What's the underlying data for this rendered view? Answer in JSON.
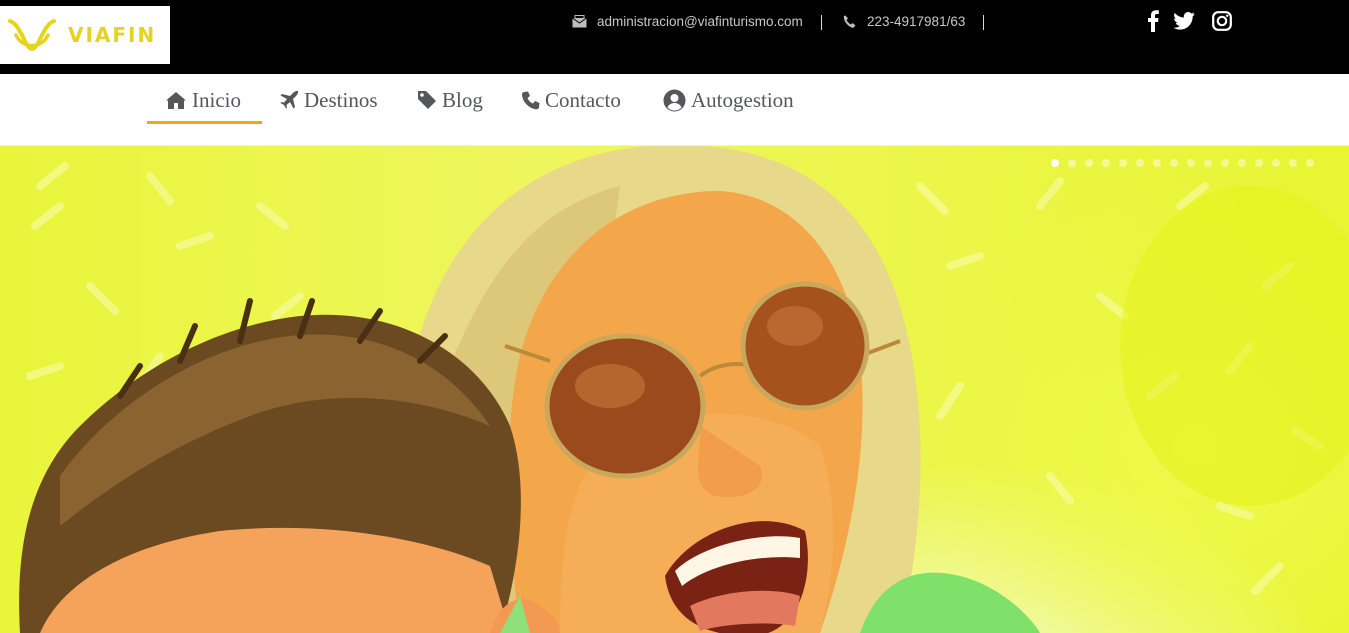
{
  "header": {
    "logo_text": "VIAFIN",
    "email": "administracion@viafinturismo.com",
    "phone": "223-4917981/63",
    "social": [
      {
        "icon": "facebook-icon"
      },
      {
        "icon": "twitter-icon"
      },
      {
        "icon": "instagram-icon"
      }
    ]
  },
  "nav": {
    "items": [
      {
        "label": "Inicio",
        "icon": "home-icon",
        "active": true
      },
      {
        "label": "Destinos",
        "icon": "plane-icon"
      },
      {
        "label": "Blog",
        "icon": "tag-icon"
      },
      {
        "label": "Contacto",
        "icon": "phone-icon"
      },
      {
        "label": "Autogestion",
        "icon": "user-circle-icon"
      }
    ]
  },
  "slider": {
    "slide_count": 16,
    "active_index": 0
  },
  "colors": {
    "brand_yellow": "#e5d31d",
    "accent_orange": "#f0a814",
    "topbar": "#000000",
    "nav_text": "#55575c"
  }
}
